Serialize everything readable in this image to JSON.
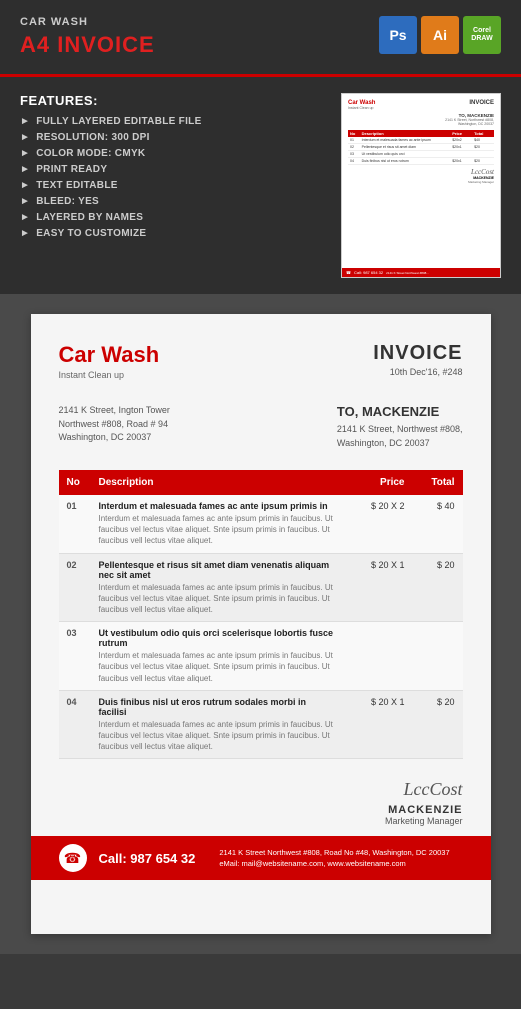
{
  "top": {
    "product_type": "CAR WASH",
    "product_title": "A4 INVOICE",
    "badges": [
      {
        "id": "ps",
        "label": "Ps",
        "class": "badge-ps"
      },
      {
        "id": "ai",
        "label": "Ai",
        "class": "badge-ai"
      },
      {
        "id": "corel",
        "label": "CorelDRAW",
        "class": "badge-corel"
      }
    ]
  },
  "features": {
    "title": "FEATURES:",
    "items": [
      "FULLY LAYERED EDITABLE FILE",
      "RESOLUTION: 300 DPI",
      "COLOR MODE: CMYK",
      "PRINT READY",
      "TEXT EDITABLE",
      "BLEED: YES",
      "LAYERED BY NAMES",
      "EASY TO CUSTOMIZE"
    ]
  },
  "invoice": {
    "brand_name": "Car Wash",
    "brand_sub": "Instant Clean up",
    "title": "INVOICE",
    "date": "10th Dec'16, #248",
    "from": {
      "line1": "2141 K Street, Ington Tower",
      "line2": "Northwest #808, Road # 94",
      "line3": "Washington, DC 20037"
    },
    "to": {
      "label": "TO, MACKENZIE",
      "line1": "2141 K Street, Northwest #808,",
      "line2": "Washington, DC 20037"
    },
    "table": {
      "headers": [
        "No",
        "Description",
        "Price",
        "Total"
      ],
      "rows": [
        {
          "no": "01",
          "title": "Interdum et malesuada fames ac ante ipsum primis in",
          "desc": "Interdum et malesuada fames ac ante ipsum primis in faucibus. Ut faucibus vel lectus vitae aliquet. Snte ipsum primis in faucibus. Ut faucibus vell lectus vitae aliquet.",
          "price": "$ 20 X 2",
          "total": "$ 40"
        },
        {
          "no": "02",
          "title": "Pellentesque et risus sit amet diam venenatis aliquam nec sit amet",
          "desc": "Interdum et malesuada fames ac ante ipsum primis in faucibus. Ut faucibus vel lectus vitae aliquet. Snte ipsum primis in faucibus. Ut faucibus vell lectus vitae aliquet.",
          "price": "$ 20 X 1",
          "total": "$ 20"
        },
        {
          "no": "03",
          "title": "Ut vestibulum odio quis orci scelerisque lobortis fusce rutrum",
          "desc": "Interdum et malesuada fames ac ante ipsum primis in faucibus. Ut faucibus vel lectus vitae aliquet. Snte ipsum primis in faucibus. Ut faucibus vell lectus vitae aliquet.",
          "price": "",
          "total": ""
        },
        {
          "no": "04",
          "title": "Duis finibus nisl ut eros rutrum sodales morbi in facilisi",
          "desc": "Interdum et malesuada fames ac ante ipsum primis in faucibus. Ut faucibus vel lectus vitae aliquet. Snte ipsum primis in faucibus. Ut faucibus vell lectus vitae aliquet.",
          "price": "$ 20 X 1",
          "total": "$ 20"
        }
      ]
    },
    "signature": {
      "image_text": "LccCost",
      "name": "MACKENZIE",
      "title": "Marketing Manager"
    },
    "footer": {
      "phone_label": "Call: 987 654 32",
      "address": "2141 K Street Northwest #808, Road No #48, Washington, DC 20037",
      "email": "eMail: mail@websitename.com, www.websitename.com"
    }
  }
}
